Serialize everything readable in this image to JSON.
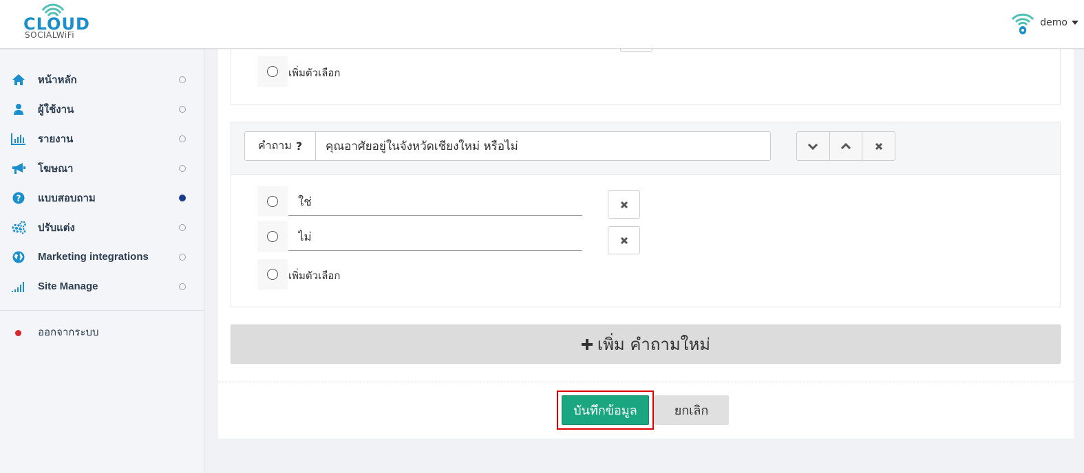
{
  "brand": {
    "logo_text": "CLOUD",
    "logo_sub": "SOCIALWiFi",
    "color": "#1b8fce"
  },
  "user": {
    "name": "demo"
  },
  "sidebar": {
    "items": [
      {
        "label": "หน้าหลัก",
        "icon": "home-icon",
        "active": false
      },
      {
        "label": "ผู้ใช้งาน",
        "icon": "user-icon",
        "active": false
      },
      {
        "label": "รายงาน",
        "icon": "bar-chart-icon",
        "active": false
      },
      {
        "label": "โฆษณา",
        "icon": "bullhorn-icon",
        "active": false
      },
      {
        "label": "แบบสอบถาม",
        "icon": "question-circle-icon",
        "active": true
      },
      {
        "label": "ปรับแต่ง",
        "icon": "gears-icon",
        "active": false
      },
      {
        "label": "Marketing integrations",
        "icon": "globe-icon",
        "active": false
      },
      {
        "label": "Site Manage",
        "icon": "signal-icon",
        "active": false
      }
    ],
    "logout_label": "ออกจากระบบ"
  },
  "survey": {
    "prev_question": {
      "add_option_label": "เพิ่มตัวเลือก"
    },
    "question": {
      "prefix_label": "คำถาม",
      "prefix_symbol": "?",
      "text": "คุณอาศัยอยู่ในจังหวัดเชียงใหม่ หรือไม่",
      "options": [
        {
          "value": "ใช่"
        },
        {
          "value": "ไม่"
        }
      ],
      "add_option_label": "เพิ่มตัวเลือก"
    },
    "add_question_label": "เพิ่ม คำถามใหม่",
    "save_label": "บันทึกข้อมูล",
    "cancel_label": "ยกเลิก"
  },
  "colors": {
    "accent": "#1aa680",
    "active_dot": "#1a3a8c",
    "logout_dot": "#d9262b",
    "highlight": "#e00000",
    "icon": "#1b8fce"
  }
}
